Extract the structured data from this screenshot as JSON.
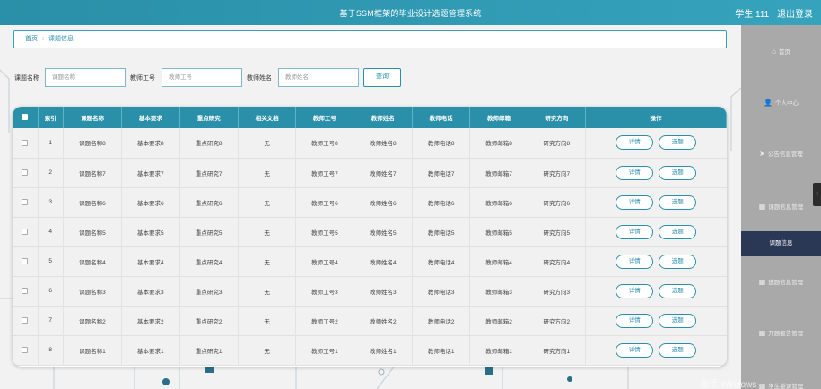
{
  "header": {
    "title": "基于SSM框架的毕业设计选题管理系统",
    "user": "学生 111",
    "logout": "退出登录"
  },
  "breadcrumb": {
    "home": "首页",
    "separator": ":",
    "current": "课题信息"
  },
  "search": {
    "topic_label": "课题名称",
    "topic_placeholder": "课题名称",
    "teacher_id_label": "教师工号",
    "teacher_id_placeholder": "教师工号",
    "teacher_name_label": "教师姓名",
    "teacher_name_placeholder": "教师姓名",
    "query_button": "查询"
  },
  "table": {
    "columns": [
      "索引",
      "课题名称",
      "基本要求",
      "重点研究",
      "相关文档",
      "教师工号",
      "教师姓名",
      "教师电话",
      "教师邮箱",
      "研究方向",
      "操作"
    ],
    "detail_label": "详情",
    "select_label": "选题",
    "rows": [
      [
        "1",
        "课题名称8",
        "基本要求8",
        "重点研究8",
        "无",
        "教师工号8",
        "教师姓名8",
        "教师电话8",
        "教师邮箱8",
        "研究方向8"
      ],
      [
        "2",
        "课题名称7",
        "基本要求7",
        "重点研究7",
        "无",
        "教师工号7",
        "教师姓名7",
        "教师电话7",
        "教师邮箱7",
        "研究方向7"
      ],
      [
        "3",
        "课题名称6",
        "基本要求6",
        "重点研究6",
        "无",
        "教师工号6",
        "教师姓名6",
        "教师电话6",
        "教师邮箱6",
        "研究方向6"
      ],
      [
        "4",
        "课题名称5",
        "基本要求5",
        "重点研究5",
        "无",
        "教师工号5",
        "教师姓名5",
        "教师电话5",
        "教师邮箱5",
        "研究方向5"
      ],
      [
        "5",
        "课题名称4",
        "基本要求4",
        "重点研究4",
        "无",
        "教师工号4",
        "教师姓名4",
        "教师电话4",
        "教师邮箱4",
        "研究方向4"
      ],
      [
        "6",
        "课题名称3",
        "基本要求3",
        "重点研究3",
        "无",
        "教师工号3",
        "教师姓名3",
        "教师电话3",
        "教师邮箱3",
        "研究方向3"
      ],
      [
        "7",
        "课题名称2",
        "基本要求2",
        "重点研究2",
        "无",
        "教师工号2",
        "教师姓名2",
        "教师电话2",
        "教师邮箱2",
        "研究方向2"
      ],
      [
        "8",
        "课题名称1",
        "基本要求1",
        "重点研究1",
        "无",
        "教师工号1",
        "教师姓名1",
        "教师电话1",
        "教师邮箱1",
        "研究方向1"
      ]
    ]
  },
  "sidebar": {
    "items": [
      {
        "label": "首页",
        "icon": "home-icon",
        "glyph": "⌂"
      },
      {
        "label": "个人中心",
        "icon": "user-icon",
        "glyph": "👤"
      },
      {
        "label": "公告信息管理",
        "icon": "send-icon",
        "glyph": "➤"
      },
      {
        "label": "课题信息管理",
        "icon": "grid-icon",
        "glyph": "▦"
      },
      {
        "label": "课题信息",
        "icon": "",
        "glyph": ""
      },
      {
        "label": "选题信息管理",
        "icon": "grid-icon",
        "glyph": "▦"
      },
      {
        "label": "开题报告管理",
        "icon": "grid-icon",
        "glyph": "▦"
      },
      {
        "label": "学生授课管理",
        "icon": "grid-icon",
        "glyph": "▦"
      }
    ],
    "active_index": 4
  },
  "watermark": "激活 Windows",
  "colors": {
    "primary": "#2a8fa8",
    "sidebar_bg": "#a9a9a9",
    "active_bg": "#2a3856"
  }
}
